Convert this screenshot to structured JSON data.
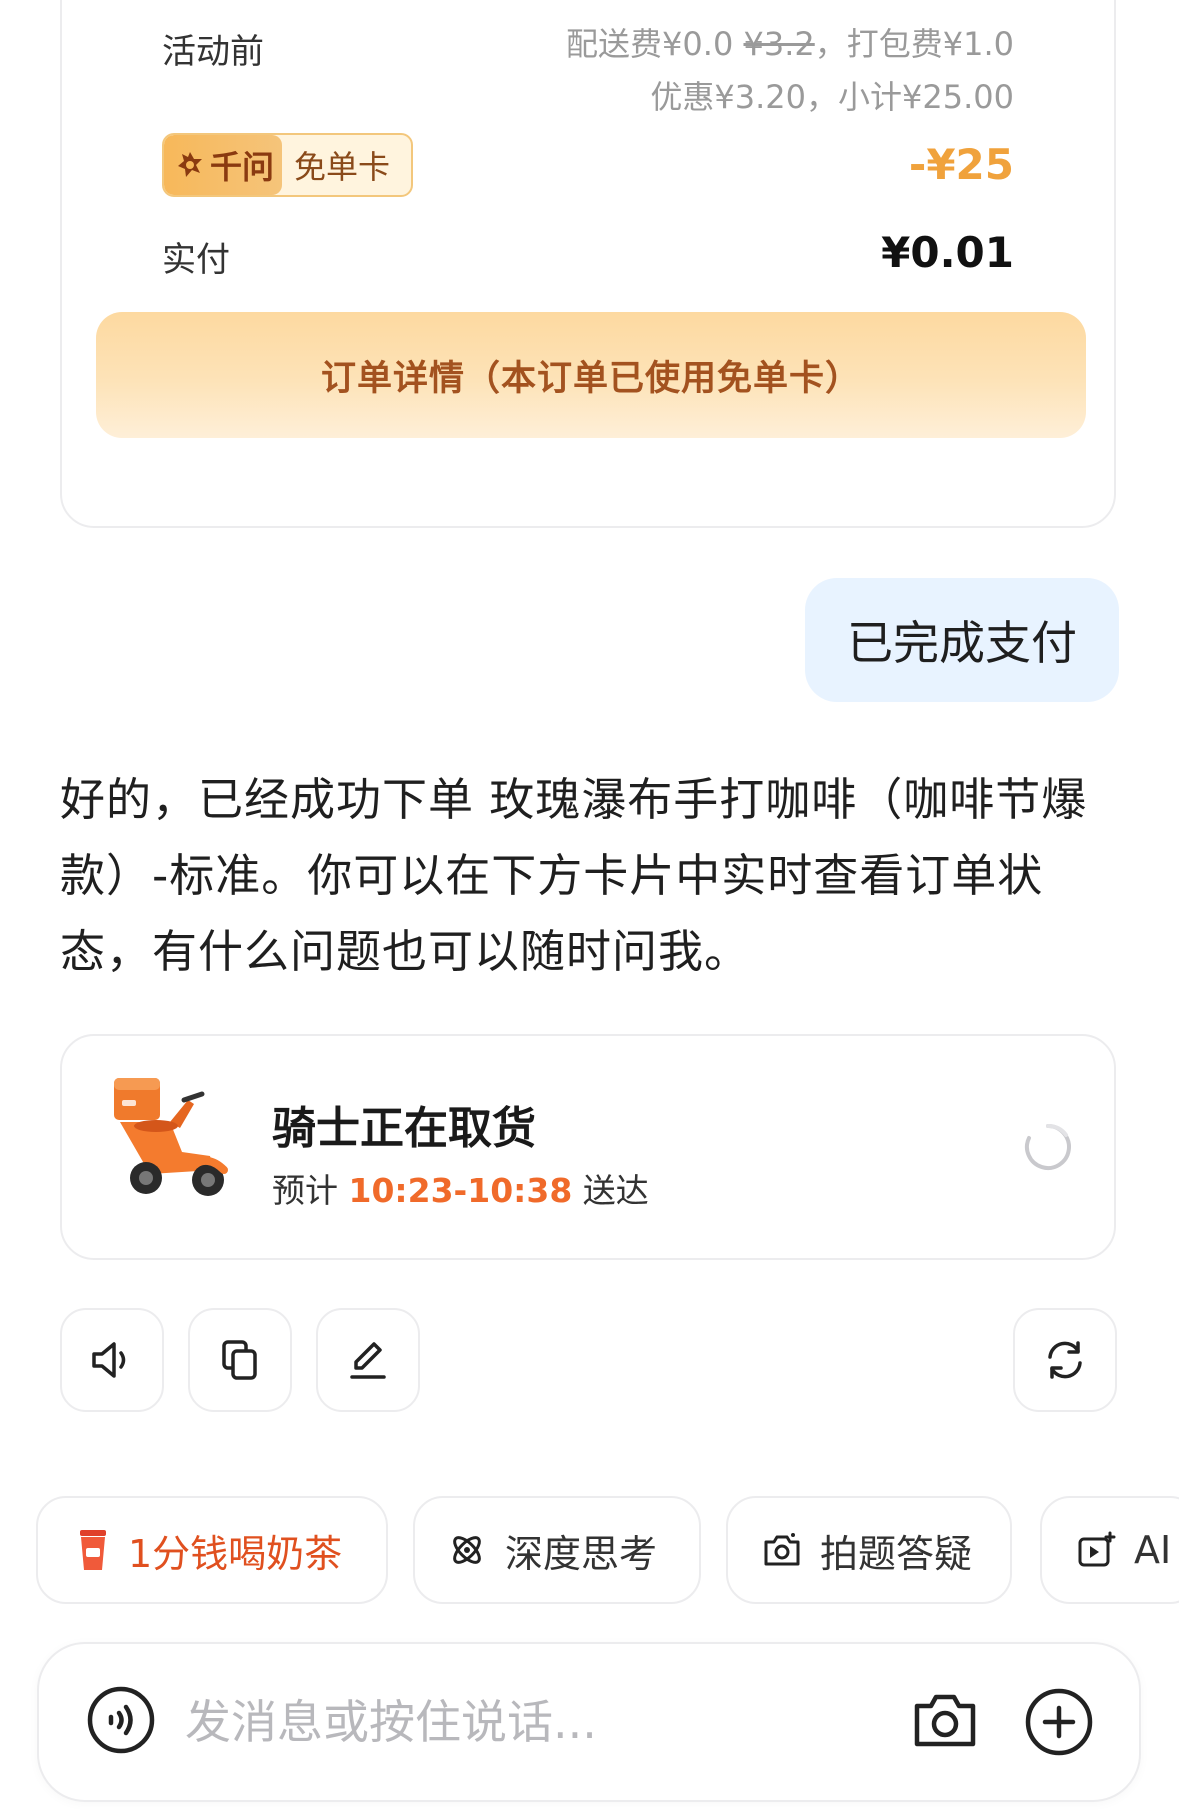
{
  "payment_card": {
    "label_before_promo": "活动前",
    "fees_line1_prefix": "配送费¥0.0",
    "fees_line1_strike": "¥3.2",
    "fees_line1_suffix": "，打包费¥1.0",
    "fees_line2": "优惠¥3.20，小计¥25.00",
    "badge_brand": "千问",
    "badge_kind": "免单卡",
    "discount_amount": "-¥25",
    "paid_label": "实付",
    "paid_amount": "¥0.01",
    "order_detail_button": "订单详情（本订单已使用免单卡）"
  },
  "user_message": "已完成支付",
  "assistant_message": "好的，已经成功下单 玫瑰瀑布手打咖啡（咖啡节爆款）-标准。你可以在下方卡片中实时查看订单状态，有什么问题也可以随时问我。",
  "delivery_card": {
    "title": "骑士正在取货",
    "eta_prefix": "预计 ",
    "eta_time": "10:23-10:38",
    "eta_suffix": " 送达",
    "icons": [
      "scooter-icon",
      "refresh-icon"
    ]
  },
  "actions": {
    "icons": [
      "speaker-icon",
      "copy-icon",
      "edit-icon",
      "regenerate-icon"
    ]
  },
  "quick_chips": [
    {
      "label": "1分钱喝奶茶",
      "icon": "milk-tea-icon"
    },
    {
      "label": "深度思考",
      "icon": "deep-think-icon"
    },
    {
      "label": "拍题答疑",
      "icon": "photo-question-icon"
    },
    {
      "label": "AI",
      "icon": "ai-video-icon"
    }
  ],
  "input_bar": {
    "placeholder": "发消息或按住说话...",
    "icons": [
      "voice-icon",
      "camera-icon",
      "plus-icon"
    ]
  },
  "colors": {
    "accent_orange": "#f06a2a",
    "discount_orange": "#f0a23c",
    "user_bubble": "#e8f3ff",
    "border": "#ececee"
  }
}
